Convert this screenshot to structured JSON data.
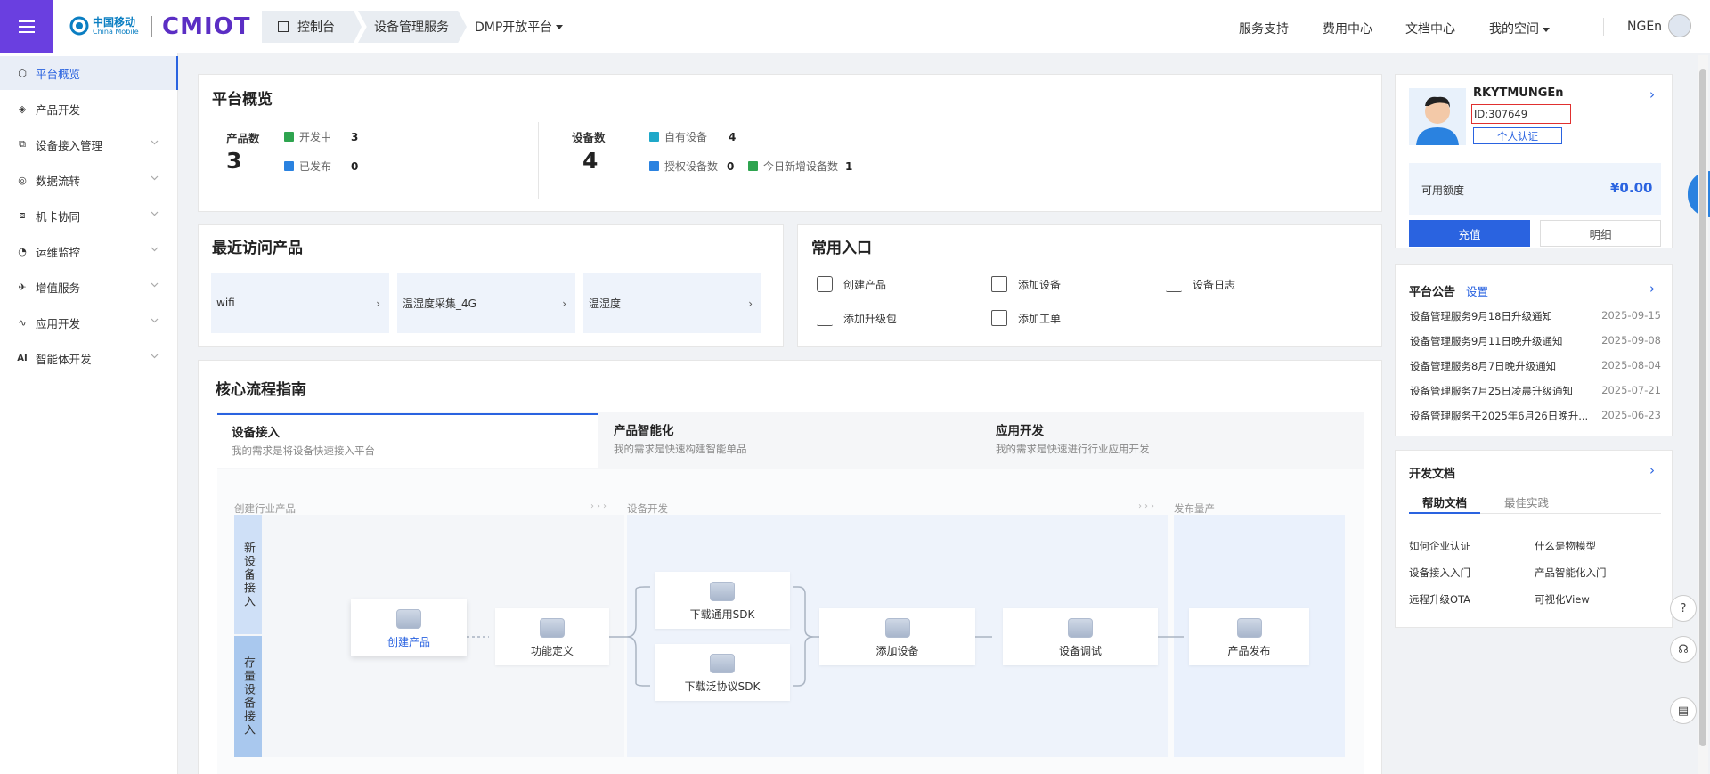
{
  "header": {
    "logo_cn": "中国移动",
    "logo_en": "China Mobile",
    "logo_brand": "CMIOT",
    "breadcrumb": [
      "控制台",
      "设备管理服务"
    ],
    "platform_menu": "DMP开放平台",
    "nav": [
      "服务支持",
      "费用中心",
      "文档中心",
      "我的空间"
    ],
    "username": "NGEn",
    "colors": {
      "accent": "#6a3fe0",
      "primary": "#2a63e0"
    }
  },
  "sidebar": {
    "items": [
      {
        "label": "平台概览",
        "icon": "overview-icon"
      },
      {
        "label": "产品开发",
        "icon": "cube-icon"
      },
      {
        "label": "设备接入管理",
        "icon": "device-access-icon"
      },
      {
        "label": "数据流转",
        "icon": "data-flow-icon"
      },
      {
        "label": "机卡协同",
        "icon": "sim-card-icon"
      },
      {
        "label": "运维监控",
        "icon": "monitor-icon"
      },
      {
        "label": "增值服务",
        "icon": "value-service-icon"
      },
      {
        "label": "应用开发",
        "icon": "app-dev-icon"
      },
      {
        "label": "智能体开发",
        "icon": "ai-icon"
      }
    ],
    "ai_badge": "AI"
  },
  "overview": {
    "title": "平台概览",
    "product_label": "产品数",
    "product_count": "3",
    "developing_label": "开发中",
    "developing_count": "3",
    "published_label": "已发布",
    "published_count": "0",
    "device_label": "设备数",
    "device_count": "4",
    "own_label": "自有设备",
    "own_count": "4",
    "auth_label": "授权设备数",
    "auth_count": "0",
    "today_label": "今日新增设备数",
    "today_count": "1"
  },
  "recent": {
    "title": "最近访问产品",
    "items": [
      "wifi",
      "温湿度采集_4G",
      "温湿度"
    ]
  },
  "entries": {
    "title": "常用入口",
    "items": [
      "创建产品",
      "添加设备",
      "设备日志",
      "添加升级包",
      "添加工单"
    ]
  },
  "guide": {
    "title": "核心流程指南",
    "tabs": [
      {
        "title": "设备接入",
        "sub": "我的需求是将设备快速接入平台"
      },
      {
        "title": "产品智能化",
        "sub": "我的需求是快速构建智能单品"
      },
      {
        "title": "应用开发",
        "sub": "我的需求是快速进行行业应用开发"
      }
    ],
    "phases": [
      "创建行业产品",
      "设备开发",
      "发布量产"
    ],
    "lanes": [
      "新设备接入",
      "存量设备接入"
    ],
    "nodes": [
      "创建产品",
      "功能定义",
      "下载通用SDK",
      "下载泛协议SDK",
      "添加设备",
      "设备调试",
      "产品发布"
    ]
  },
  "profile": {
    "name": "RKYTMUNGEn",
    "id": "ID:307649",
    "verify": "个人认证",
    "balance_label": "可用额度",
    "balance": "¥0.00",
    "recharge": "充值",
    "detail": "明细"
  },
  "notices": {
    "title": "平台公告",
    "setting": "设置",
    "items": [
      {
        "text": "设备管理服务9月18日升级通知",
        "date": "2025-09-15"
      },
      {
        "text": "设备管理服务9月11日晚升级通知",
        "date": "2025-09-08"
      },
      {
        "text": "设备管理服务8月7日晚升级通知",
        "date": "2025-08-04"
      },
      {
        "text": "设备管理服务7月25日凌晨升级通知",
        "date": "2025-07-21"
      },
      {
        "text": "设备管理服务于2025年6月26日晚升...",
        "date": "2025-06-23"
      }
    ]
  },
  "docs": {
    "title": "开发文档",
    "tabs": [
      "帮助文档",
      "最佳实践"
    ],
    "links": [
      "如何企业认证",
      "什么是物模型",
      "设备接入入门",
      "产品智能化入门",
      "远程升级OTA",
      "可视化View"
    ]
  }
}
